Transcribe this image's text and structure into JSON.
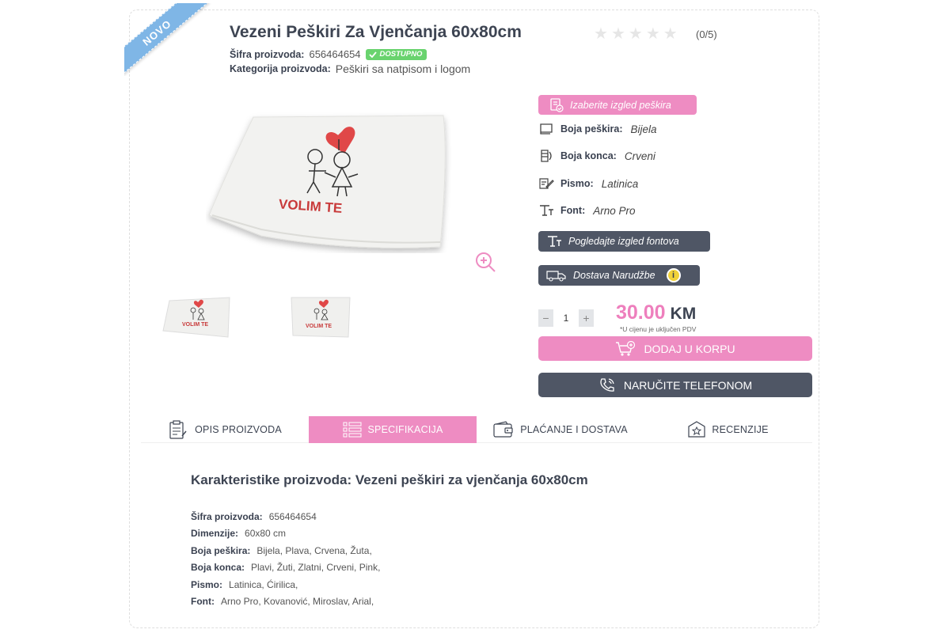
{
  "ribbon": "NOVO",
  "product": {
    "title": "Vezeni Peškiri Za Vjenčanja 60x80cm",
    "rating_text": "(0/5)",
    "stars": 0,
    "sku_label": "Šifra proizvoda:",
    "sku_value": "656464654",
    "availability": "DOSTUPNO",
    "category_label": "Kategorija proizvoda:",
    "category_value": "Peškiri sa natpisom i logom"
  },
  "options": {
    "choose_button": "Izaberite izgled peškira",
    "attributes": [
      {
        "label": "Boja peškira:",
        "value": "Bijela",
        "icon": "towel-icon"
      },
      {
        "label": "Boja konca:",
        "value": "Crveni",
        "icon": "thread-icon"
      },
      {
        "label": "Pismo:",
        "value": "Latinica",
        "icon": "pen-icon"
      },
      {
        "label": "Font:",
        "value": "Arno Pro",
        "icon": "font-icon"
      }
    ],
    "fonts_button": "Pogledajte izgled fontova",
    "delivery_button": "Dostava Narudžbe",
    "info_glyph": "i"
  },
  "purchase": {
    "qty_minus": "−",
    "qty_value": "1",
    "qty_plus": "+",
    "price": "30.00",
    "currency": "KM",
    "pdv_note": "*U cijenu je uključen PDV",
    "add_to_cart": "DODAJ U KORPU",
    "order_phone": "NARUČITE TELEFONOM"
  },
  "image": {
    "embroidery_text": "VOLIM TE"
  },
  "tabs": [
    {
      "label": "OPIS PROIZVODA",
      "active": false
    },
    {
      "label": "SPECIFIKACIJA",
      "active": true
    },
    {
      "label": "PLAĆANJE I DOSTAVA",
      "active": false
    },
    {
      "label": "RECENZIJE",
      "active": false
    }
  ],
  "specs": {
    "title": "Karakteristike proizvoda:  Vezeni peškiri za vjenčanja 60x80cm",
    "rows": [
      {
        "label": "Šifra proizvoda:",
        "value": "656464654"
      },
      {
        "label": "Dimenzije:",
        "value": "60x80 cm"
      },
      {
        "label": "Boja peškira:",
        "value": "Bijela, Plava, Crvena, Žuta,"
      },
      {
        "label": "Boja konca:",
        "value": "Plavi, Žuti, Zlatni, Crveni, Pink,"
      },
      {
        "label": "Pismo:",
        "value": "Latinica, Ćirilica,"
      },
      {
        "label": "Font:",
        "value": "Arno Pro, Kovanović, Miroslav, Arial,"
      }
    ]
  },
  "colors": {
    "pink": "#ee8cc2",
    "dark": "#4f5665",
    "price": "#ee7fbd",
    "available": "#69d36e",
    "ribbon": "#7fb6e6"
  }
}
